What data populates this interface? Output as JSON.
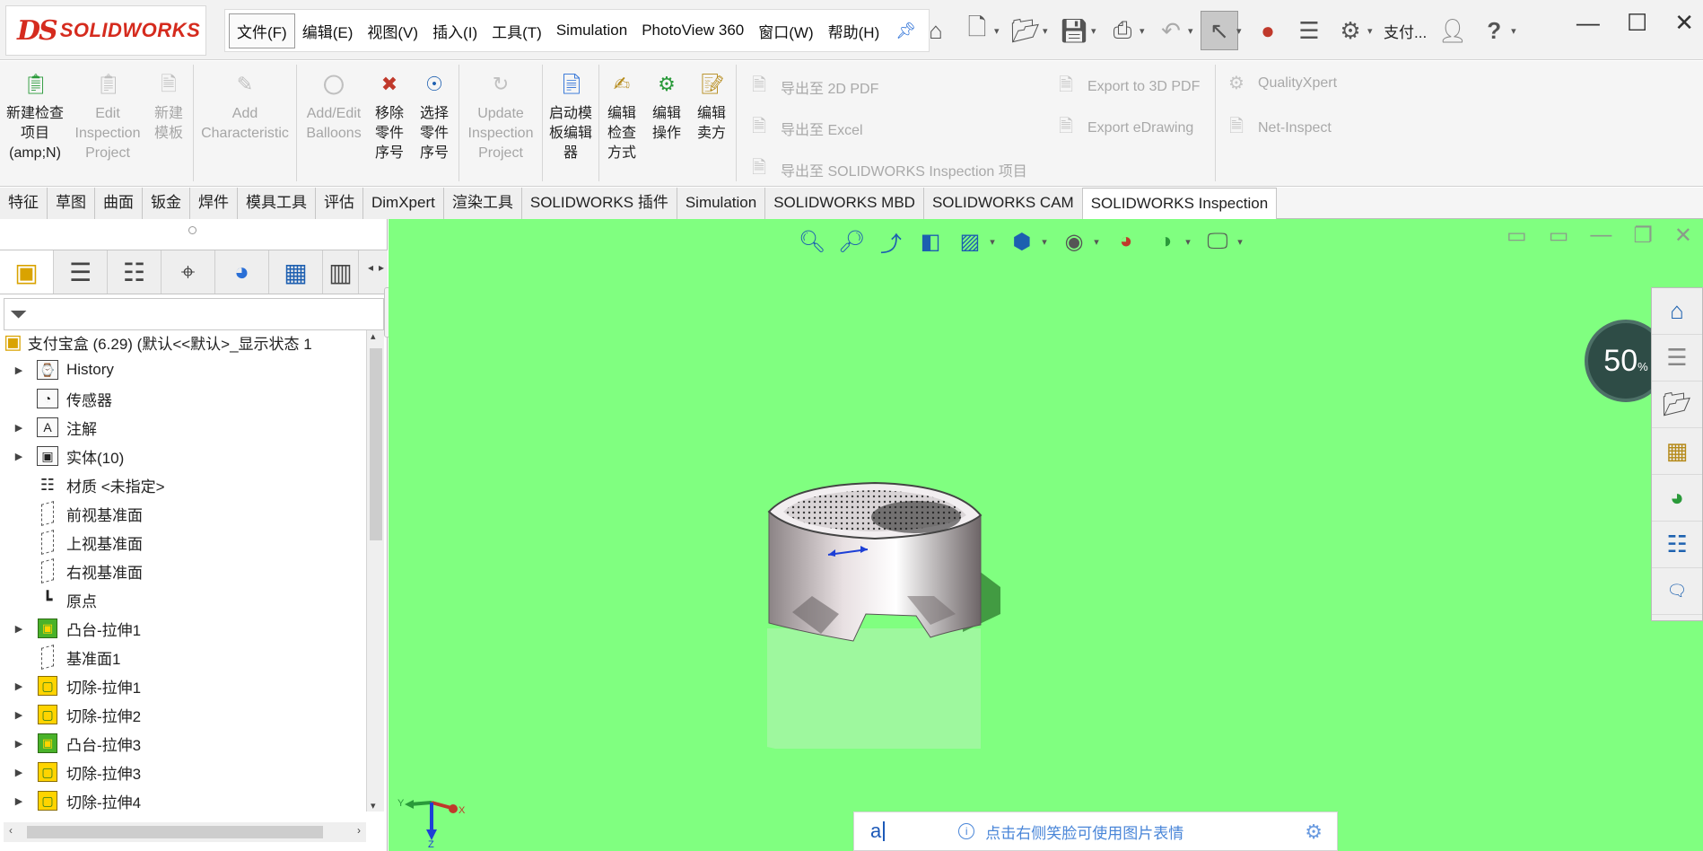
{
  "app": {
    "logo_mark": "DS",
    "logo_text": "SOLIDWORKS"
  },
  "menu": {
    "items": [
      "文件(F)",
      "编辑(E)",
      "视图(V)",
      "插入(I)",
      "工具(T)",
      "Simulation",
      "PhotoView 360",
      "窗口(W)",
      "帮助(H)"
    ],
    "user_label": "支付..."
  },
  "ribbon": {
    "new_project": "新建检查项目(amp;N)",
    "edit_project": "Edit Inspection Project",
    "new_template": "新建模板",
    "add_characteristic": "Add Characteristic",
    "add_balloons": "Add/Edit Balloons",
    "remove_balloon": "移除零件序号",
    "select_balloon": "选择零件序号",
    "update_project": "Update Inspection Project",
    "launch_template_editor": "启动模板编辑器",
    "edit_method": "编辑检查方式",
    "edit_operation": "编辑操作",
    "edit_vendor": "编辑卖方",
    "export_2d_pdf": "导出至 2D PDF",
    "export_excel": "导出至 Excel",
    "export_sw_project": "导出至 SOLIDWORKS Inspection 项目",
    "export_3d_pdf": "Export to 3D PDF",
    "export_edrawing": "Export eDrawing",
    "quality_xpert": "QualityXpert",
    "net_inspect": "Net-Inspect"
  },
  "tabs": [
    {
      "label": "特征",
      "active": false
    },
    {
      "label": "草图",
      "active": false
    },
    {
      "label": "曲面",
      "active": false
    },
    {
      "label": "钣金",
      "active": false
    },
    {
      "label": "焊件",
      "active": false
    },
    {
      "label": "模具工具",
      "active": false
    },
    {
      "label": "评估",
      "active": false
    },
    {
      "label": "DimXpert",
      "active": false
    },
    {
      "label": "渲染工具",
      "active": false
    },
    {
      "label": "SOLIDWORKS 插件",
      "active": false
    },
    {
      "label": "Simulation",
      "active": false
    },
    {
      "label": "SOLIDWORKS MBD",
      "active": false
    },
    {
      "label": "SOLIDWORKS CAM",
      "active": false
    },
    {
      "label": "SOLIDWORKS Inspection",
      "active": true
    }
  ],
  "tree": {
    "root": "支付宝盒 (6.29) (默认<<默认>_显示状态 1",
    "items": [
      {
        "label": "History",
        "icon": "history-icon",
        "expandable": true
      },
      {
        "label": "传感器",
        "icon": "sensor-icon",
        "expandable": false
      },
      {
        "label": "注解",
        "icon": "annotation-icon",
        "expandable": true
      },
      {
        "label": "实体(10)",
        "icon": "solid-bodies-icon",
        "expandable": true
      },
      {
        "label": "材质 <未指定>",
        "icon": "material-icon",
        "expandable": false
      },
      {
        "label": "前视基准面",
        "icon": "plane-icon",
        "expandable": false
      },
      {
        "label": "上视基准面",
        "icon": "plane-icon",
        "expandable": false
      },
      {
        "label": "右视基准面",
        "icon": "plane-icon",
        "expandable": false
      },
      {
        "label": "原点",
        "icon": "origin-icon",
        "expandable": false
      },
      {
        "label": "凸台-拉伸1",
        "icon": "boss-extrude-icon",
        "expandable": true
      },
      {
        "label": "基准面1",
        "icon": "plane-icon",
        "expandable": false
      },
      {
        "label": "切除-拉伸1",
        "icon": "cut-extrude-icon",
        "expandable": true
      },
      {
        "label": "切除-拉伸2",
        "icon": "cut-extrude-icon",
        "expandable": true
      },
      {
        "label": "凸台-拉伸3",
        "icon": "boss-extrude-icon",
        "expandable": true
      },
      {
        "label": "切除-拉伸3",
        "icon": "cut-extrude-icon",
        "expandable": true
      },
      {
        "label": "切除-拉伸4",
        "icon": "cut-extrude-icon",
        "expandable": true
      }
    ]
  },
  "viewport": {
    "background_color": "#80ff80",
    "zoom_gauge": "50",
    "zoom_unit": "%",
    "triad": {
      "x": "X",
      "y": "Y",
      "z": "Z"
    }
  },
  "ime": {
    "typed": "a",
    "hint": "点击右侧笑脸可使用图片表情"
  }
}
